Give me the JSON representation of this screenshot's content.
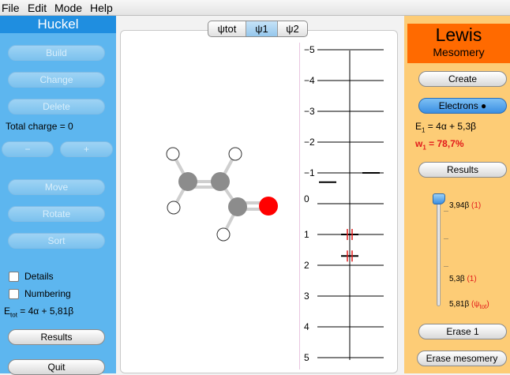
{
  "menubar": {
    "file": "File",
    "edit": "Edit",
    "mode": "Mode",
    "help": "Help"
  },
  "left_panel": {
    "title": "Huckel",
    "build": "Build",
    "change": "Change",
    "delete": "Delete",
    "total_charge": "Total charge = 0",
    "minus": "−",
    "plus": "+",
    "move": "Move",
    "rotate": "Rotate",
    "sort": "Sort",
    "details": "Details",
    "numbering": "Numbering",
    "etot_label": "E",
    "etot_sub": "tot",
    "etot_value": " = 4α + 5,81β",
    "results": "Results",
    "quit": "Quit"
  },
  "center_panel": {
    "tabs": [
      {
        "label": "ψtot",
        "selected": false
      },
      {
        "label": "ψ1",
        "selected": true
      },
      {
        "label": "ψ2",
        "selected": false
      }
    ],
    "energy_axis": {
      "ticks": [
        "−5",
        "−4",
        "−3",
        "−2",
        "−1",
        "0",
        "1",
        "2",
        "3",
        "4",
        "5"
      ],
      "levels": [
        {
          "value": -1.0,
          "column": "right",
          "electrons": 0
        },
        {
          "value": -0.7,
          "column": "left",
          "electrons": 0
        },
        {
          "value": 1.0,
          "column": "center",
          "electrons": 2
        },
        {
          "value": 1.7,
          "column": "center",
          "electrons": 2
        }
      ]
    },
    "molecule": {
      "atoms": [
        {
          "element": "H"
        },
        {
          "element": "H"
        },
        {
          "element": "C"
        },
        {
          "element": "C"
        },
        {
          "element": "H"
        },
        {
          "element": "C"
        },
        {
          "element": "O"
        },
        {
          "element": "H"
        }
      ]
    }
  },
  "right_panel": {
    "title": "Lewis",
    "subtitle": "Mesomery",
    "create": "Create",
    "electrons": "Electrons ●",
    "e1_label": "E",
    "e1_sub": "1",
    "e1_value": " = 4α + 5,3β",
    "w1_label": "w",
    "w1_sub": "1",
    "w1_value": " = 78,7%",
    "results": "Results",
    "slider_position": 0.0,
    "slider_labels": [
      {
        "text": "3,94β",
        "tag": "(1)"
      },
      {
        "text": "5,3β",
        "tag": "(1)"
      },
      {
        "text": "5,81β",
        "tag": "(ψ",
        "tag_sub": "tot",
        "tag_end": ")"
      }
    ],
    "erase1": "Erase 1",
    "erase_mesomery": "Erase mesomery"
  },
  "colors": {
    "left_bg": "#5db6ef",
    "left_title_bg": "#1f8ee0",
    "right_bg": "#fdcc76",
    "right_title_bg": "#ff6a00",
    "accent_red": "#e21b1b",
    "carbon": "#8c8c8c",
    "oxygen": "#ff0000",
    "hydrogen": "#ffffff"
  }
}
